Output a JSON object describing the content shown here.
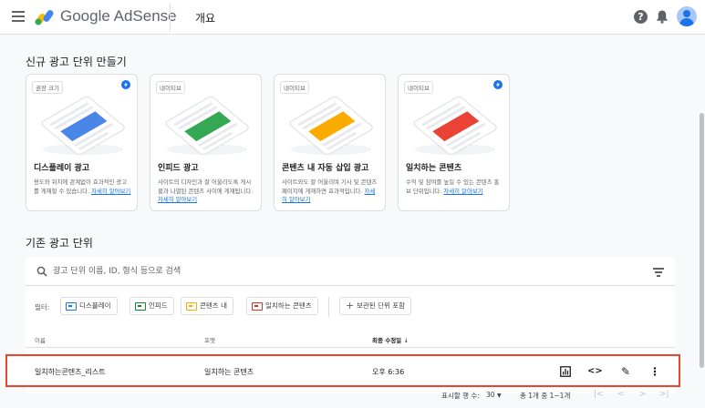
{
  "header": {
    "brand_google": "Google",
    "brand_product": "AdSense",
    "page_title": "개요",
    "help_glyph": "?"
  },
  "new_units": {
    "title": "신규 광고 단위 만들기",
    "cards": [
      {
        "badge": "권장 크기",
        "title": "디스플레이 광고",
        "desc": "용도와 위치에 관계없이 효과적인 광고를 게재할 수 있습니다.",
        "link": "자세히 알아보기",
        "accent": "#4a86e8",
        "has_bolt": true
      },
      {
        "badge": "네이티브",
        "title": "인피드 광고",
        "desc": "사이트의 디자인과 잘 어울리도록 게시물과 나열된 콘텐츠 사이에 게재됩니다.",
        "link": "자세히 알아보기",
        "accent": "#34a853",
        "has_bolt": false
      },
      {
        "badge": "네이티브",
        "title": "콘텐츠 내 자동 삽입 광고",
        "desc": "사이트와도 잘 어울리며 기사 및 콘텐츠 페이지에 게재하면 효과적입니다.",
        "link": "자세히 알아보기",
        "accent": "#f9ab00",
        "has_bolt": false
      },
      {
        "badge": "네이티브",
        "title": "일치하는 콘텐츠",
        "desc": "수익 및 참여를 높일 수 있는 콘텐츠 홍보 단위입니다.",
        "link": "자세히 알아보기",
        "accent": "#ea4335",
        "has_bolt": true
      }
    ]
  },
  "existing": {
    "title": "기존 광고 단위",
    "search_placeholder": "광고 단위 이름, ID, 형식 등으로 검색",
    "filter_label": "필터:",
    "chips": [
      {
        "label": "디스플레이",
        "color": "#1a73e8"
      },
      {
        "label": "인피드",
        "color": "#188038"
      },
      {
        "label": "콘텐츠 내",
        "color": "#f9ab00"
      },
      {
        "label": "일치하는 콘텐츠",
        "color": "#d93025"
      }
    ],
    "archived_chip": "보관된 단위 포함",
    "columns": {
      "name": "이름",
      "format": "포맷",
      "modified": "최종 수정일"
    },
    "rows": [
      {
        "name": "일치하는콘텐츠_리스트",
        "format": "일치하는 콘텐츠",
        "modified": "오후 6:36"
      }
    ],
    "actions": {
      "code_glyph": "<>",
      "edit_glyph": "✎",
      "more_glyph": "⋮"
    }
  },
  "pagination": {
    "rows_per_page_label": "표시할 행 수:",
    "rows_per_page_value": "30",
    "range": "총 1개 중 1~1개",
    "first_glyph": "|<",
    "prev_glyph": "<",
    "next_glyph": ">",
    "last_glyph": ">|"
  }
}
